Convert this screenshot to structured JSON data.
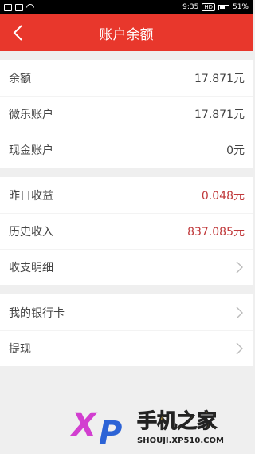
{
  "status_bar": {
    "time": "9:35",
    "network_badge": "HD",
    "battery": "51%"
  },
  "header": {
    "title": "账户余额"
  },
  "summary": [
    {
      "label": "余额",
      "value": "17.871元"
    },
    {
      "label": "微乐账户",
      "value": "17.871元"
    },
    {
      "label": "现金账户",
      "value": "0元"
    }
  ],
  "income": [
    {
      "label": "昨日收益",
      "value": "0.048元"
    },
    {
      "label": "历史收入",
      "value": "837.085元"
    },
    {
      "label": "收支明细"
    }
  ],
  "actions": [
    {
      "label": "我的银行卡"
    },
    {
      "label": "提现"
    }
  ],
  "watermark": {
    "logo": "XP",
    "name": "手机之家",
    "url": "SHOUJI.XP510.COM"
  },
  "colors": {
    "header_bg": "#e8372c",
    "value_red": "#c0393b",
    "page_bg": "#efefef"
  }
}
